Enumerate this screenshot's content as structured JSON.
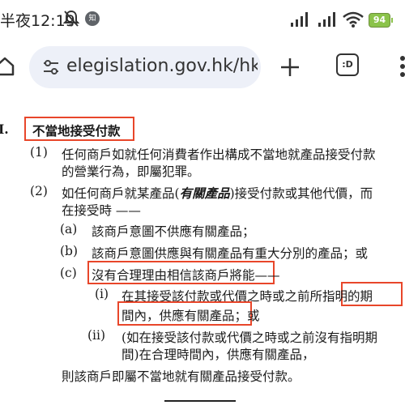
{
  "status_bar": {
    "time": "半夜12:19",
    "notification_badge": "知",
    "battery": "94"
  },
  "browser": {
    "url": "elegislation.gov.hk/hk",
    "tabs_label": ":D"
  },
  "section": {
    "number": "I.",
    "title": "不當地接受付款"
  },
  "sub1": {
    "num": "(1)",
    "line1": "任何商戶如就任何消費者作出構成不當地就產品接受付款",
    "line2": "的營業行為，即屬犯罪。"
  },
  "sub2": {
    "num": "(2)",
    "line1_a": "如任何商戶就某產品(",
    "line1_term": "有關產品",
    "line1_b": ")接受付款或其他代價，而",
    "line2": "在接受時 ——"
  },
  "para_a": {
    "num": "(a)",
    "text": "該商戶意圖不供應有關產品；"
  },
  "para_b": {
    "num": "(b)",
    "text": "該商戶意圖供應與有關產品有重大分別的產品；或"
  },
  "para_c": {
    "num": "(c)",
    "text_highlight": "沒有合理理由相信該商戶將能",
    "text_rest": "——"
  },
  "sub_i": {
    "num": "(i)",
    "line1_a": "在其接受該付款或代價之時或之前所",
    "line1_hl": "指明的期",
    "line2_hl": "間內，供應有關產品",
    "line2_rest": "；或"
  },
  "sub_ii": {
    "num": "(ii)",
    "line1": "(如在接受該付款或代價之時或之前沒有指明期",
    "line2": "間)在合理時間內，供應有關產品，"
  },
  "conclusion": "則該商戶即屬不當地就有關產品接受付款。",
  "colors": {
    "highlight": "#e8462a",
    "url_bar": "#edf0f8",
    "battery": "#8bc34a"
  }
}
